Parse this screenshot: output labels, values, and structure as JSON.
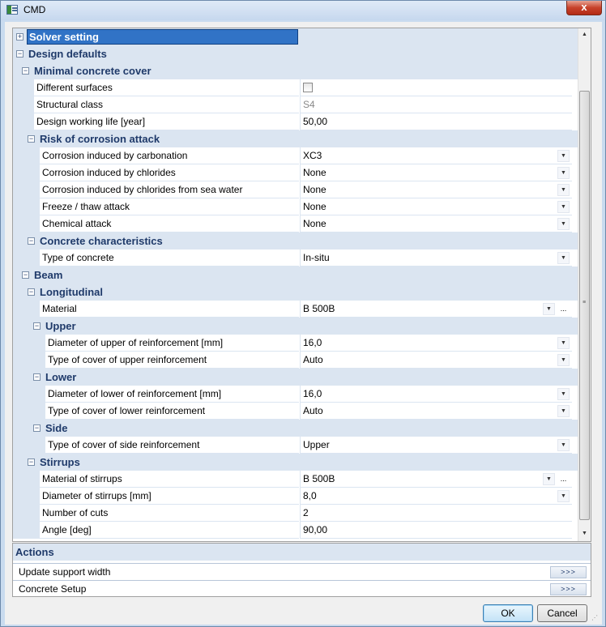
{
  "window": {
    "title": "CMD",
    "close_label": "x"
  },
  "solver": {
    "label": "Solver setting",
    "toggle": "+"
  },
  "rows": [
    {
      "kind": "group",
      "label": "Design defaults",
      "toggle": "−"
    },
    {
      "kind": "group",
      "label": "Minimal concrete cover",
      "toggle": "−"
    },
    {
      "kind": "prop",
      "label": "Different surfaces",
      "value": "",
      "checkbox": true
    },
    {
      "kind": "prop",
      "label": "Structural class",
      "value": "S4",
      "dim": true
    },
    {
      "kind": "prop",
      "label": "Design working life [year]",
      "value": "50,00"
    },
    {
      "kind": "group",
      "label": "Risk of corrosion attack",
      "toggle": "−"
    },
    {
      "kind": "prop",
      "label": "Corrosion induced by carbonation",
      "value": "XC3",
      "dropdown": true
    },
    {
      "kind": "prop",
      "label": "Corrosion induced by chlorides",
      "value": "None",
      "dropdown": true
    },
    {
      "kind": "prop",
      "label": "Corrosion induced by chlorides from sea water",
      "value": "None",
      "dropdown": true
    },
    {
      "kind": "prop",
      "label": "Freeze / thaw attack",
      "value": "None",
      "dropdown": true
    },
    {
      "kind": "prop",
      "label": "Chemical attack",
      "value": "None",
      "dropdown": true
    },
    {
      "kind": "group",
      "label": "Concrete characteristics",
      "toggle": "−"
    },
    {
      "kind": "prop",
      "label": "Type of concrete",
      "value": "In-situ",
      "dropdown": true
    },
    {
      "kind": "group",
      "label": "Beam",
      "toggle": "−"
    },
    {
      "kind": "group",
      "label": "Longitudinal",
      "toggle": "−"
    },
    {
      "kind": "prop",
      "label": "Material",
      "value": "B 500B",
      "dropdown": true,
      "ellipsis": true
    },
    {
      "kind": "group",
      "label": "Upper",
      "toggle": "−"
    },
    {
      "kind": "prop",
      "label": "Diameter of upper of reinforcement [mm]",
      "value": "16,0",
      "dropdown": true
    },
    {
      "kind": "prop",
      "label": "Type of cover of upper reinforcement",
      "value": "Auto",
      "dropdown": true
    },
    {
      "kind": "group",
      "label": "Lower",
      "toggle": "−"
    },
    {
      "kind": "prop",
      "label": "Diameter of lower of reinforcement [mm]",
      "value": "16,0",
      "dropdown": true
    },
    {
      "kind": "prop",
      "label": "Type of cover of lower reinforcement",
      "value": "Auto",
      "dropdown": true
    },
    {
      "kind": "group",
      "label": "Side",
      "toggle": "−"
    },
    {
      "kind": "prop",
      "label": "Type of cover of side reinforcement",
      "value": "Upper",
      "dropdown": true
    },
    {
      "kind": "group",
      "label": "Stirrups",
      "toggle": "−"
    },
    {
      "kind": "prop",
      "label": "Material of stirrups",
      "value": "B 500B",
      "dropdown": true,
      "ellipsis": true
    },
    {
      "kind": "prop",
      "label": "Diameter of stirrups [mm]",
      "value": "8,0",
      "dropdown": true
    },
    {
      "kind": "prop",
      "label": "Number of cuts",
      "value": "2"
    },
    {
      "kind": "prop",
      "label": "Angle [deg]",
      "value": "90,00"
    }
  ],
  "actions": {
    "header": "Actions",
    "items": [
      {
        "label": "Update support width",
        "button": ">>>"
      },
      {
        "label": "Concrete Setup",
        "button": ">>>"
      }
    ]
  },
  "buttons": {
    "ok": "OK",
    "cancel": "Cancel"
  },
  "icons": {
    "dropdown": "▼",
    "ellipsis": "...",
    "scroll_up": "▲",
    "scroll_down": "▼",
    "grip": "≡",
    "size_grip": "⋰"
  },
  "colors": {
    "group_bg": "#dbe5f1",
    "group_text": "#1f3a6a",
    "selection": "#3173c6"
  }
}
